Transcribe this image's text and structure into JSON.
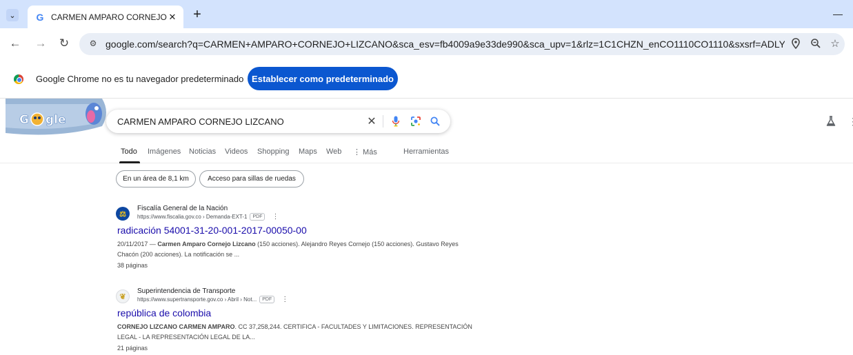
{
  "browser": {
    "tab_title": "CARMEN AMPARO CORNEJO LI",
    "url": "google.com/search?q=CARMEN+AMPARO+CORNEJO+LIZCANO&sca_esv=fb4009a9e33de990&sca_upv=1&rlz=1C1CHZN_enCO1110CO1110&sxsrf=ADLYWIJoQs...",
    "icons": [
      "tab-search-icon",
      "google-favicon",
      "close-icon",
      "plus-icon",
      "minimize-icon",
      "back-icon",
      "forward-icon",
      "reload-icon",
      "site-info-icon",
      "location-icon",
      "zoom-icon",
      "star-icon"
    ]
  },
  "infobar": {
    "message": "Google Chrome no es tu navegador predeterminado",
    "button_label": "Establecer como predeterminado"
  },
  "search": {
    "query": "CARMEN AMPARO CORNEJO LIZCANO",
    "icons": [
      "clear-icon",
      "voice-search-icon",
      "lens-icon",
      "search-icon",
      "labs-icon",
      "more-icon"
    ]
  },
  "tabs": {
    "todo": "Todo",
    "imagenes": "Imágenes",
    "noticias": "Noticias",
    "videos": "Videos",
    "shopping": "Shopping",
    "maps": "Maps",
    "web": "Web",
    "mas": "⋮ Más",
    "herramientas": "Herramientas"
  },
  "chips": {
    "area": "En un área de 8,1 km",
    "accesibilidad": "Acceso para sillas de ruedas"
  },
  "results": [
    {
      "site": "Fiscalía General de la Nación",
      "url": "https://www.fiscalia.gov.co › Demanda-EXT-1",
      "badge": "PDF",
      "title": "radicación 54001-31-20-001-2017-00050-00",
      "snippet_date": "20/11/2017 — ",
      "snippet_bold": "Carmen Amparo Cornejo Lizcano",
      "snippet_rest": " (150 acciones). Alejandro Reyes Cornejo (150 acciones). Gustavo Reyes Chacón (200 acciones). La notificación se ...",
      "pages": "38 páginas"
    },
    {
      "site": "Superintendencia de Transporte",
      "url": "https://www.supertransporte.gov.co › Abril › Not...",
      "badge": "PDF",
      "title": "república de colombia",
      "snippet_bold": "CORNEJO LIZCANO CARMEN AMPARO",
      "snippet_rest": ". CC 37,258,244. CERTIFICA - FACULTADES Y LIMITACIONES. REPRESENTACIÓN LEGAL - LA REPRESENTACIÓN LEGAL DE LA...",
      "pages": "21 páginas"
    }
  ],
  "colors": {
    "tabstrip": "#d3e3fd",
    "omnibox": "#e9eef6",
    "button_primary": "#0b57d0",
    "link": "#1a0dab"
  }
}
